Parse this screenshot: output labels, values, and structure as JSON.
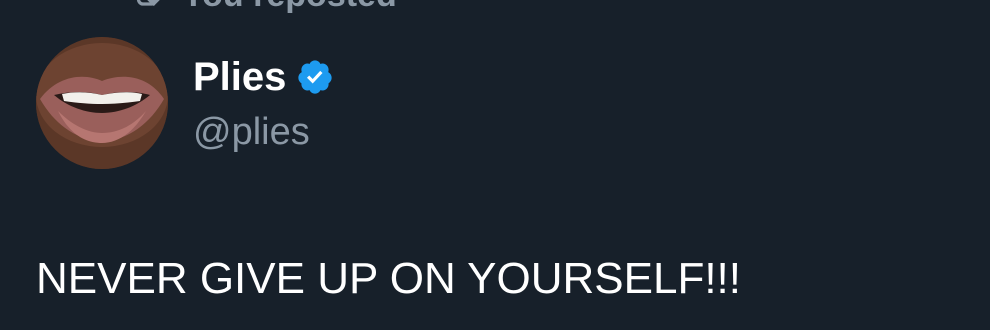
{
  "repost": {
    "icon": "repost-icon",
    "label": "You reposted"
  },
  "tweet": {
    "author": {
      "display_name": "Plies",
      "handle": "@plies",
      "verified": true,
      "verified_color": "#1d9bf0",
      "avatar": "avatar"
    },
    "text": "NEVER GIVE UP ON YOURSELF!!!"
  },
  "colors": {
    "background": "#17202a",
    "primary_text": "#ffffff",
    "secondary_text": "#8b98a5"
  }
}
